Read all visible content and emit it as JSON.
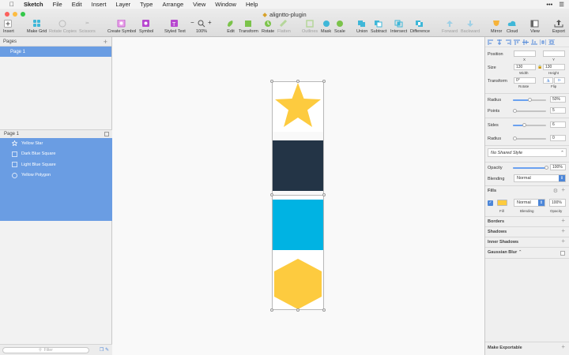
{
  "menubar": {
    "app": "Sketch",
    "items": [
      "File",
      "Edit",
      "Insert",
      "Layer",
      "Type",
      "Arrange",
      "View",
      "Window",
      "Help"
    ]
  },
  "window": {
    "title": "aligntto-plugin"
  },
  "toolbar": {
    "insert": "Insert",
    "make_grid": "Make Grid",
    "rotate_copies": "Rotate Copies",
    "scissors": "Scissors",
    "create_symbol": "Create Symbol",
    "symbol": "Symbol",
    "styled_text": "Styled Text",
    "zoom_minus": "−",
    "zoom_plus": "+",
    "zoom": "100%",
    "edit": "Edit",
    "transform": "Transform",
    "rotate": "Rotate",
    "flatten": "Flatten",
    "outlines": "Outlines",
    "mask": "Mask",
    "scale": "Scale",
    "union": "Union",
    "subtract": "Subtract",
    "intersect": "Intersect",
    "difference": "Difference",
    "forward": "Forward",
    "backward": "Backward",
    "mirror": "Mirror",
    "cloud": "Cloud",
    "view": "View",
    "export": "Export"
  },
  "sidebar": {
    "pages_header": "Pages",
    "pages": [
      "Page 1"
    ],
    "layers_header": "Page 1",
    "layers": [
      {
        "name": "Yellow Star",
        "icon": "star-icon"
      },
      {
        "name": "Dark Blue Square",
        "icon": "rectangle-icon"
      },
      {
        "name": "Light Blue Square",
        "icon": "rectangle-icon"
      },
      {
        "name": "Yellow Polygon",
        "icon": "polygon-icon"
      }
    ],
    "filter_placeholder": "Filter"
  },
  "canvas": {
    "shapes": [
      {
        "name": "Yellow Star",
        "color": "#fdcb3f"
      },
      {
        "name": "Dark Blue Square",
        "color": "#233446"
      },
      {
        "name": "Light Blue Square",
        "color": "#00b3e3"
      },
      {
        "name": "Yellow Polygon",
        "color": "#fdcb3f"
      }
    ]
  },
  "inspector": {
    "position_label": "Position",
    "x_label": "X",
    "y_label": "Y",
    "x_value": "",
    "y_value": "",
    "size_label": "Size",
    "width_value": "130",
    "height_value": "130",
    "width_label": "Width",
    "height_label": "Height",
    "transform_label": "Transform",
    "rotate_value": "0°",
    "rotate_label": "Rotate",
    "flip_label": "Flip",
    "radius_label": "Radius",
    "radius_value": "50%",
    "radius_fraction": 0.5,
    "points_label": "Points",
    "points_value": "5",
    "points_fraction": 0.05,
    "sides_label": "Sides",
    "sides_value": "6",
    "sides_fraction": 0.35,
    "radius2_label": "Radius",
    "radius2_value": "0",
    "radius2_fraction": 0,
    "shared_style": "No Shared Style",
    "opacity_label": "Opacity",
    "opacity_value": "100%",
    "opacity_fraction": 1.0,
    "blending_label": "Blending",
    "blending_value": "Normal",
    "fills_label": "Fills",
    "fill_blending": "Normal",
    "fill_opacity": "100%",
    "fill_color": "#fdcb3f",
    "fill_label": "Fill",
    "fill_blending_label": "Blending",
    "fill_opacity_label": "Opacity",
    "borders_label": "Borders",
    "shadows_label": "Shadows",
    "inner_shadows_label": "Inner Shadows",
    "gaussian_blur_label": "Gaussian Blur",
    "make_exportable": "Make Exportable"
  }
}
